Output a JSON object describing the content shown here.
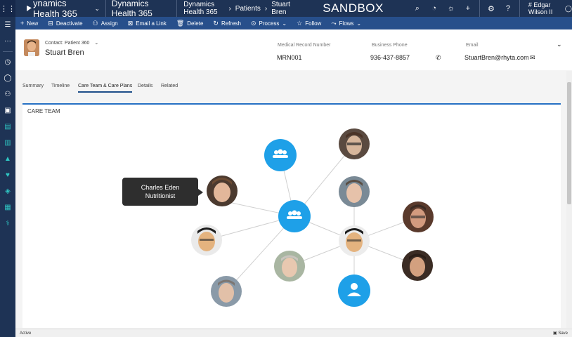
{
  "topbar": {
    "brand": "ynamics Health 365",
    "app": "Dynamics Health 365",
    "breadcrumbs": [
      "Dynamics Health 365",
      "Patients",
      "Stuart Bren"
    ],
    "environment": "SANDBOX",
    "user": "# Edgar Wilson II",
    "icons": [
      "search-icon",
      "task-icon",
      "lightbulb-icon",
      "plus-icon",
      "gear-icon",
      "help-icon",
      "user-icon"
    ]
  },
  "commands": [
    {
      "icon": "+",
      "label": "New"
    },
    {
      "icon": "⊟",
      "label": "Deactivate"
    },
    {
      "icon": "⚇",
      "label": "Assign"
    },
    {
      "icon": "⊠",
      "label": "Email a Link"
    },
    {
      "icon": "🗑",
      "label": "Delete"
    },
    {
      "icon": "↻",
      "label": "Refresh"
    },
    {
      "icon": "⊙",
      "label": "Process",
      "dropdown": "⌄"
    },
    {
      "icon": "☆",
      "label": "Follow"
    },
    {
      "icon": "⤳",
      "label": "Flows",
      "dropdown": "⌄"
    }
  ],
  "record": {
    "type": "Contact: Patient 360",
    "name": "Stuart Bren",
    "fields": [
      {
        "label": "Medical Record Number",
        "value": "MRN001"
      },
      {
        "label": "Business Phone",
        "value": "936-437-8857"
      },
      {
        "label": "Email",
        "value": "StuartBren@rhyta.com"
      }
    ]
  },
  "tabs": [
    {
      "label": "Summary",
      "active": false
    },
    {
      "label": "Timeline",
      "active": false
    },
    {
      "label": "Care Team & Care Plans",
      "active": true
    },
    {
      "label": "Details",
      "active": false
    },
    {
      "label": "Related",
      "active": false
    }
  ],
  "care_team": {
    "title": "CARE TEAM",
    "tooltip": {
      "name": "Charles Eden",
      "role": "Nutritionist"
    }
  },
  "status": {
    "left": "Active",
    "right": "Save"
  },
  "colors": {
    "topbar": "#1e3355",
    "cmdbar": "#274f8b",
    "node_blue": "#1ea0e8",
    "accent": "#2670c4"
  }
}
